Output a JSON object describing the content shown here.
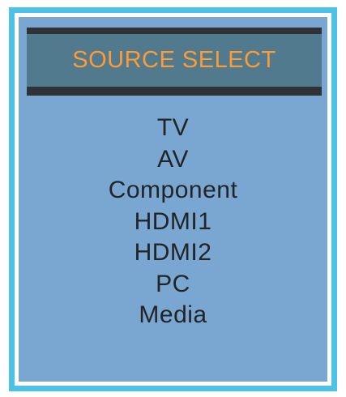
{
  "menu": {
    "title": "SOURCE SELECT",
    "items": [
      {
        "label": "TV"
      },
      {
        "label": "AV"
      },
      {
        "label": "Component"
      },
      {
        "label": "HDMI1"
      },
      {
        "label": "HDMI2"
      },
      {
        "label": "PC"
      },
      {
        "label": "Media"
      }
    ]
  },
  "colors": {
    "frame_border": "#4cc2e8",
    "panel_background": "#7aa7d1",
    "header_background": "#527a8e",
    "header_bars": "#2f3338",
    "title_text": "#ff9b34",
    "item_text": "#222426"
  }
}
